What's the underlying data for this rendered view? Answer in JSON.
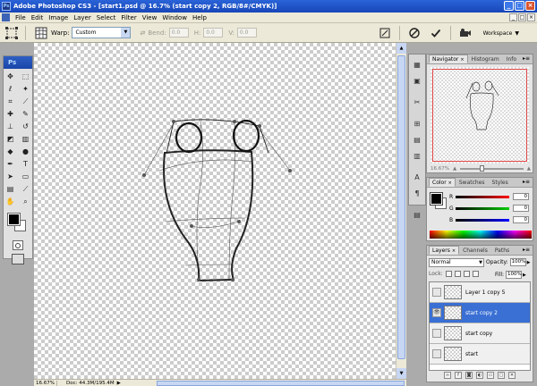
{
  "window": {
    "title": "Adobe Photoshop CS3 - [start1.psd @ 16.7% (start copy 2, RGB/8#/CMYK)]",
    "app_icon": "Ps",
    "controls": [
      "minimize",
      "maximize",
      "close"
    ]
  },
  "menubar": {
    "items": [
      "File",
      "Edit",
      "Image",
      "Layer",
      "Select",
      "Filter",
      "View",
      "Window",
      "Help"
    ]
  },
  "options": {
    "warp_label": "Warp:",
    "warp_value": "Custom",
    "bend_label": "Bend:",
    "bend_value": "0.0",
    "h_label": "H:",
    "h_value": "0.0",
    "v_label": "V:",
    "v_value": "0.0",
    "workspace_label": "Workspace"
  },
  "toolbox": {
    "logo": "Ps",
    "tools": [
      "move",
      "marquee",
      "lasso",
      "magic-wand",
      "crop",
      "slice",
      "healing",
      "brush",
      "clone-stamp",
      "history-brush",
      "eraser",
      "gradient",
      "blur",
      "dodge",
      "pen",
      "type",
      "path-select",
      "shape",
      "notes",
      "eyedropper",
      "hand",
      "zoom"
    ]
  },
  "navigator": {
    "tabs": [
      "Navigator",
      "Histogram",
      "Info"
    ],
    "zoom": "16.67%"
  },
  "color": {
    "tabs": [
      "Color",
      "Swatches",
      "Styles"
    ],
    "channels": [
      {
        "label": "R",
        "value": "0",
        "color": "#ff0000"
      },
      {
        "label": "G",
        "value": "0",
        "color": "#00cc00"
      },
      {
        "label": "B",
        "value": "0",
        "color": "#0000ff"
      }
    ]
  },
  "layers": {
    "tabs": [
      "Layers",
      "Channels",
      "Paths"
    ],
    "blend_mode": "Normal",
    "opacity_label": "Opacity:",
    "opacity_value": "100%",
    "lock_label": "Lock:",
    "fill_label": "Fill:",
    "fill_value": "100%",
    "items": [
      {
        "name": "Layer 1 copy 5",
        "visible": false,
        "selected": false
      },
      {
        "name": "start copy 2",
        "visible": true,
        "selected": true
      },
      {
        "name": "start copy",
        "visible": false,
        "selected": false
      },
      {
        "name": "start",
        "visible": false,
        "selected": false
      }
    ]
  },
  "status": {
    "zoom": "16.67%",
    "doc_size": "Doc: 44.3M/195.4M"
  }
}
